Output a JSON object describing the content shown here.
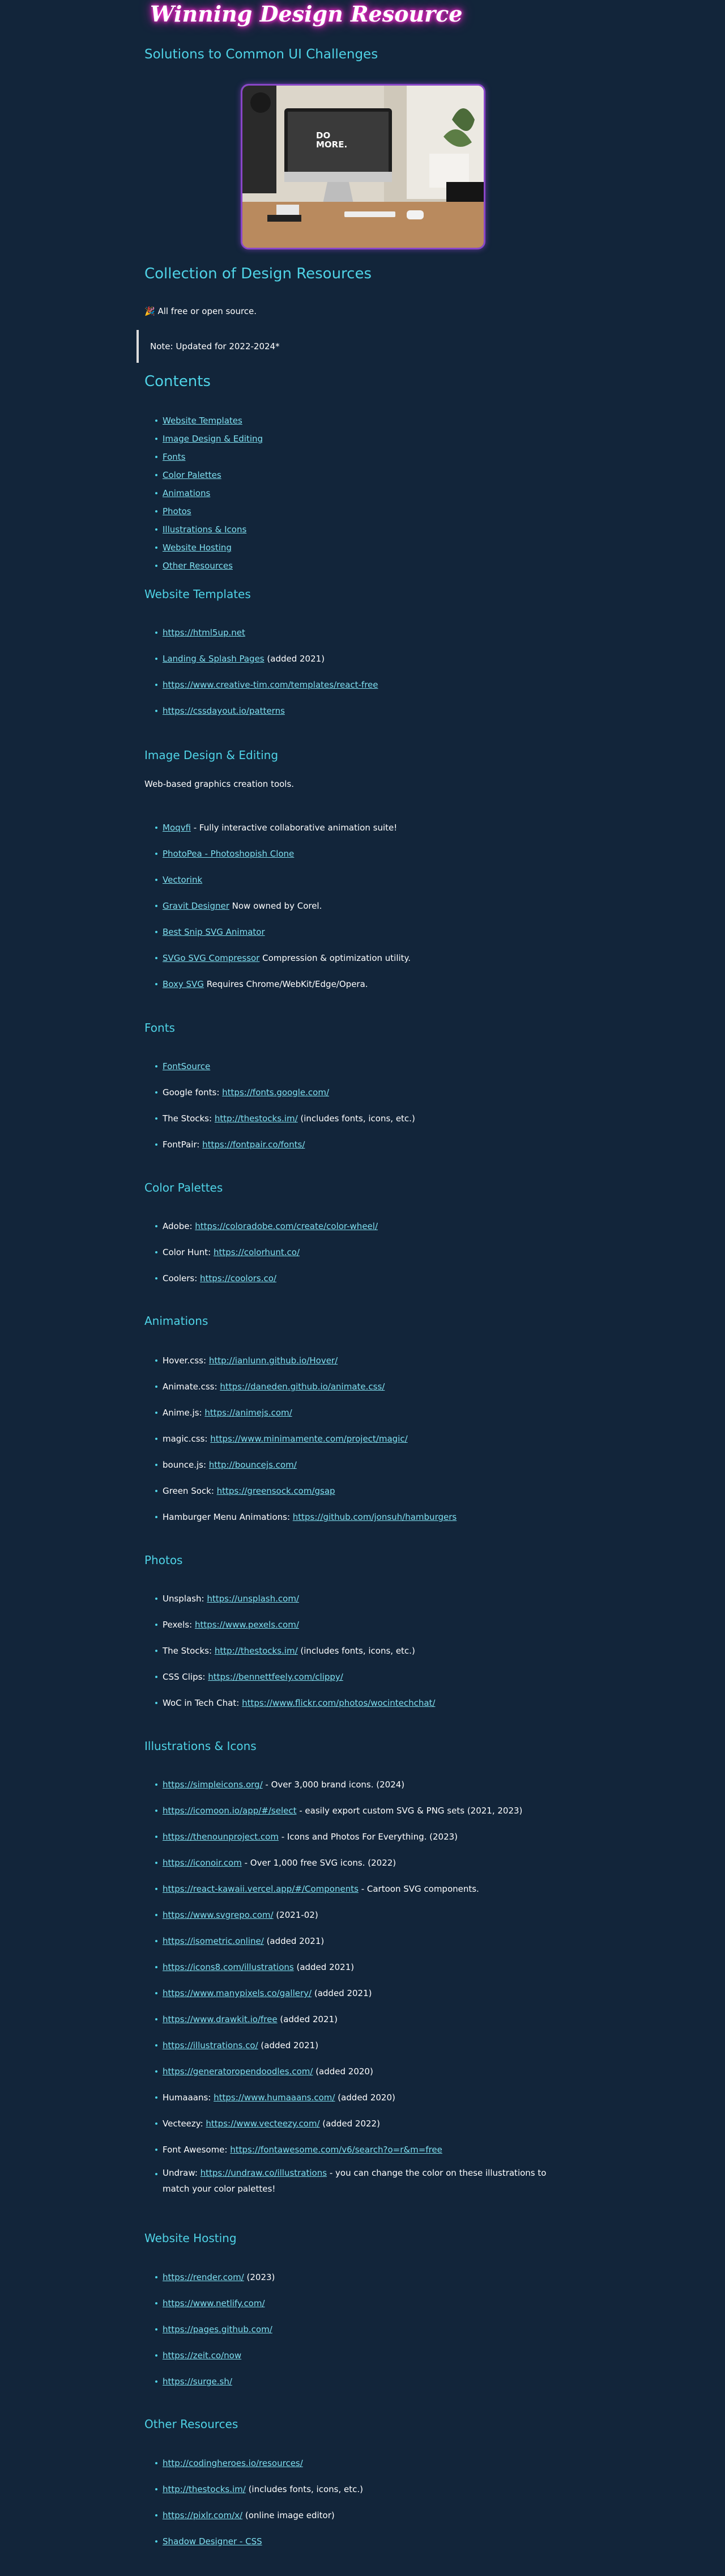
{
  "hero": {
    "title": "Winning Design Resource",
    "subtitle": "Solutions to Common UI Challenges",
    "image_screen_text": "DO MORE."
  },
  "intro": {
    "heading": "Collection of Design Resources",
    "free_text": "🎉 All free or open source.",
    "note": "Note: Updated for 2022-2024*"
  },
  "contents": {
    "heading": "Contents",
    "items": [
      "Website Templates",
      "Image Design & Editing",
      "Fonts",
      "Color Palettes",
      "Animations",
      "Photos",
      "Illustrations & Icons",
      "Website Hosting",
      "Other Resources"
    ]
  },
  "templates": {
    "heading": "Website Templates",
    "items": [
      {
        "pre": "",
        "link": "https://html5up.net",
        "post": ""
      },
      {
        "pre": "",
        "link": "Landing & Splash Pages",
        "post": " (added 2021)"
      },
      {
        "pre": "",
        "link": "https://www.creative-tim.com/templates/react-free",
        "post": ""
      },
      {
        "pre": "",
        "link": "https://cssdayout.io/patterns",
        "post": ""
      }
    ]
  },
  "image_design": {
    "heading": "Image Design & Editing",
    "desc": "Web-based graphics creation tools.",
    "items": [
      {
        "pre": "",
        "link": "Moqvfi",
        "post": " - Fully interactive collaborative animation suite!"
      },
      {
        "pre": "",
        "link": "PhotoPea - Photoshopish Clone",
        "post": ""
      },
      {
        "pre": "",
        "link": "Vectorink",
        "post": ""
      },
      {
        "pre": "",
        "link": "Gravit Designer",
        "post": " Now owned by Corel."
      },
      {
        "pre": "",
        "link": "Best Snip SVG Animator",
        "post": ""
      },
      {
        "pre": "",
        "link": "SVGo SVG Compressor",
        "post": " Compression & optimization utility."
      },
      {
        "pre": "",
        "link": "Boxy SVG",
        "post": " Requires Chrome/WebKit/Edge/Opera."
      }
    ]
  },
  "fonts": {
    "heading": "Fonts",
    "items": [
      {
        "pre": "",
        "link": "FontSource",
        "post": ""
      },
      {
        "pre": "Google fonts: ",
        "link": "https://fonts.google.com/",
        "post": ""
      },
      {
        "pre": "The Stocks: ",
        "link": "http://thestocks.im/",
        "post": " (includes fonts, icons, etc.)"
      },
      {
        "pre": "FontPair: ",
        "link": "https://fontpair.co/fonts/",
        "post": ""
      }
    ]
  },
  "palettes": {
    "heading": "Color Palettes",
    "items": [
      {
        "pre": "Adobe: ",
        "link": "https://coloradobe.com/create/color-wheel/",
        "post": ""
      },
      {
        "pre": "Color Hunt: ",
        "link": "https://colorhunt.co/",
        "post": ""
      },
      {
        "pre": "Coolers: ",
        "link": "https://coolors.co/",
        "post": ""
      }
    ]
  },
  "animations": {
    "heading": "Animations",
    "items": [
      {
        "pre": "Hover.css: ",
        "link": "http://ianlunn.github.io/Hover/",
        "post": ""
      },
      {
        "pre": "Animate.css: ",
        "link": "https://daneden.github.io/animate.css/",
        "post": ""
      },
      {
        "pre": "Anime.js: ",
        "link": "https://animejs.com/",
        "post": ""
      },
      {
        "pre": "magic.css: ",
        "link": "https://www.minimamente.com/project/magic/",
        "post": ""
      },
      {
        "pre": "bounce.js: ",
        "link": "http://bouncejs.com/",
        "post": ""
      },
      {
        "pre": "Green Sock: ",
        "link": "https://greensock.com/gsap",
        "post": ""
      },
      {
        "pre": "Hamburger Menu Animations: ",
        "link": "https://github.com/jonsuh/hamburgers",
        "post": ""
      }
    ]
  },
  "photos": {
    "heading": "Photos",
    "items": [
      {
        "pre": "Unsplash: ",
        "link": "https://unsplash.com/",
        "post": ""
      },
      {
        "pre": "Pexels: ",
        "link": "https://www.pexels.com/",
        "post": ""
      },
      {
        "pre": "The Stocks: ",
        "link": "http://thestocks.im/",
        "post": " (includes fonts, icons, etc.)"
      },
      {
        "pre": "CSS Clips: ",
        "link": "https://bennettfeely.com/clippy/",
        "post": ""
      },
      {
        "pre": "WoC in Tech Chat: ",
        "link": "https://www.flickr.com/photos/wocintechchat/",
        "post": ""
      }
    ]
  },
  "illustrations": {
    "heading": "Illustrations & Icons",
    "items": [
      {
        "pre": "",
        "link": "https://simpleicons.org/",
        "post": " - Over 3,000 brand icons. (2024)"
      },
      {
        "pre": "",
        "link": "https://icomoon.io/app/#/select",
        "post": " - easily export custom SVG & PNG sets (2021, 2023)"
      },
      {
        "pre": "",
        "link": "https://thenounproject.com",
        "post": " - Icons and Photos For Everything. (2023)"
      },
      {
        "pre": "",
        "link": "https://iconoir.com",
        "post": " - Over 1,000 free SVG icons. (2022)"
      },
      {
        "pre": "",
        "link": "https://react-kawaii.vercel.app/#/Components",
        "post": " - Cartoon SVG components."
      },
      {
        "pre": "",
        "link": "https://www.svgrepo.com/",
        "post": " (2021-02)"
      },
      {
        "pre": "",
        "link": "https://isometric.online/",
        "post": " (added 2021)"
      },
      {
        "pre": "",
        "link": "https://icons8.com/illustrations",
        "post": " (added 2021)"
      },
      {
        "pre": "",
        "link": "https://www.manypixels.co/gallery/",
        "post": " (added 2021)"
      },
      {
        "pre": "",
        "link": "https://www.drawkit.io/free",
        "post": " (added 2021)"
      },
      {
        "pre": "",
        "link": "https://illustrations.co/",
        "post": " (added 2021)"
      },
      {
        "pre": "",
        "link": "https://generatoropendoodles.com/",
        "post": " (added 2020)"
      },
      {
        "pre": "Humaaans: ",
        "link": "https://www.humaaans.com/",
        "post": " (added 2020)"
      },
      {
        "pre": "Vecteezy: ",
        "link": "https://www.vecteezy.com/",
        "post": " (added 2022)"
      },
      {
        "pre": "Font Awesome: ",
        "link": "https://fontawesome.com/v6/search?o=r&m=free",
        "post": ""
      },
      {
        "pre": "Undraw: ",
        "link": "https://undraw.co/illustrations",
        "post": " - you can change the color on these illustrations to match your color palettes!"
      }
    ]
  },
  "hosting": {
    "heading": "Website Hosting",
    "items": [
      {
        "pre": "",
        "link": "https://render.com/",
        "post": " (2023)"
      },
      {
        "pre": "",
        "link": "https://www.netlify.com/",
        "post": ""
      },
      {
        "pre": "",
        "link": "https://pages.github.com/",
        "post": ""
      },
      {
        "pre": "",
        "link": "https://zeit.co/now",
        "post": ""
      },
      {
        "pre": "",
        "link": "https://surge.sh/",
        "post": ""
      }
    ]
  },
  "other": {
    "heading": "Other Resources",
    "items": [
      {
        "pre": "",
        "link": "http://codingheroes.io/resources/",
        "post": ""
      },
      {
        "pre": "",
        "link": "http://thestocks.im/",
        "post": " (includes fonts, icons, etc.)"
      },
      {
        "pre": "",
        "link": "https://pixlr.com/x/",
        "post": " (online image editor)"
      },
      {
        "pre": "",
        "link": "Shadow Designer - CSS",
        "post": ""
      }
    ]
  },
  "colors": {
    "background": "#12253a",
    "heading": "#4fd3e6",
    "link": "#7fe0f0",
    "neon": "#ff2bd6"
  }
}
